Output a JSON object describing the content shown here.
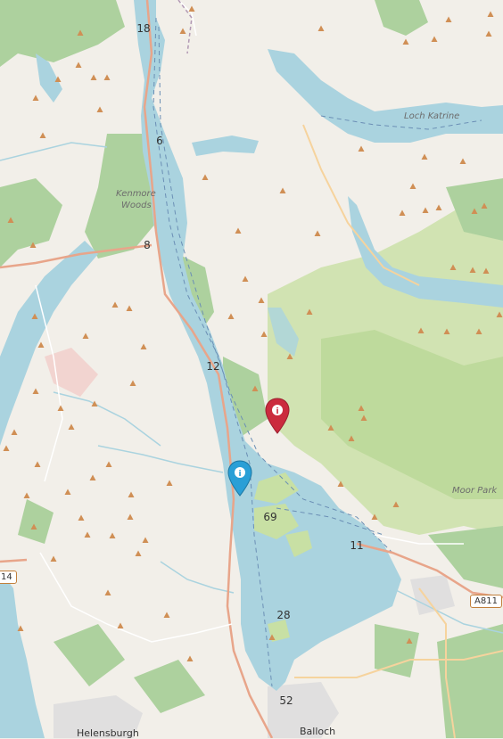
{
  "clusters": [
    {
      "label": "18",
      "size": "medium"
    },
    {
      "label": "6",
      "size": "small"
    },
    {
      "label": "8",
      "size": "small"
    },
    {
      "label": "12",
      "size": "medium"
    },
    {
      "label": "69",
      "size": "medium"
    },
    {
      "label": "11",
      "size": "medium"
    },
    {
      "label": "28",
      "size": "medium"
    },
    {
      "label": "52",
      "size": "medium"
    }
  ],
  "pins": [
    {
      "name": "red-marker",
      "icon": "info-icon",
      "glyph": "i",
      "color": "#cb2b3e"
    },
    {
      "name": "blue-marker",
      "icon": "info-icon",
      "glyph": "i",
      "color": "#2a9fd6"
    }
  ],
  "labels": {
    "loch_katrine": "Loch Katrine",
    "kenmore": "Kenmore",
    "woods": "Woods",
    "moor_park": "Moor Park",
    "helensburgh": "Helensburgh",
    "balloch": "Balloch",
    "a811": "A811",
    "road_14": "14"
  },
  "colors": {
    "land": "#f2efe9",
    "water": "#aad3df",
    "forest": "#add19e",
    "park": "#c8e0a4",
    "peak": "#d08f55",
    "main_road": "#e8a58a",
    "urban": "#e0dfdf"
  }
}
